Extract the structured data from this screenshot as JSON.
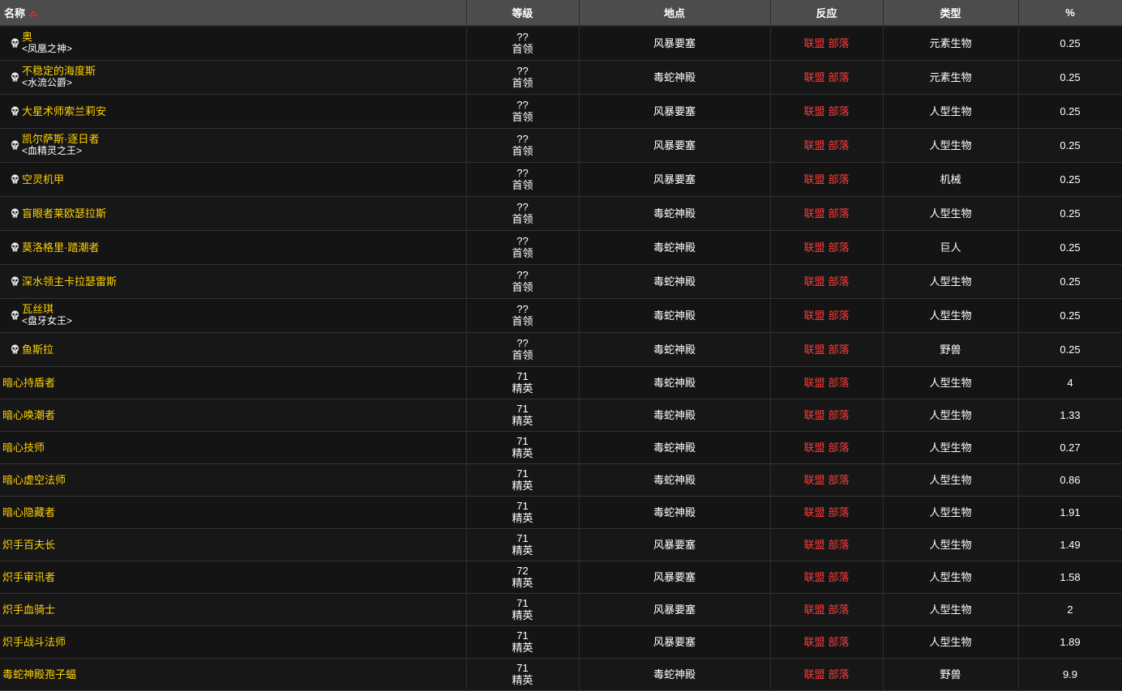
{
  "headers": {
    "name": "名称",
    "level": "等级",
    "location": "地点",
    "reaction": "反应",
    "type": "类型",
    "percent": "%"
  },
  "colors": {
    "npc_name": "#ffd100",
    "reaction": "#ff3b3b",
    "header_bg": "#4c4c4c",
    "row_bg": "#141414"
  },
  "reaction_labels": {
    "alliance": "联盟",
    "horde": "部落"
  },
  "rows": [
    {
      "boss": true,
      "name": "奥",
      "title": "<凤凰之神>",
      "level": "??",
      "rank": "首领",
      "location": "风暴要塞",
      "type": "元素生物",
      "percent": "0.25"
    },
    {
      "boss": true,
      "name": "不稳定的海度斯",
      "title": "<水流公爵>",
      "level": "??",
      "rank": "首领",
      "location": "毒蛇神殿",
      "type": "元素生物",
      "percent": "0.25"
    },
    {
      "boss": true,
      "name": "大星术师索兰莉安",
      "title": "",
      "level": "??",
      "rank": "首领",
      "location": "风暴要塞",
      "type": "人型生物",
      "percent": "0.25"
    },
    {
      "boss": true,
      "name": "凯尔萨斯·逐日者",
      "title": "<血精灵之王>",
      "level": "??",
      "rank": "首领",
      "location": "风暴要塞",
      "type": "人型生物",
      "percent": "0.25"
    },
    {
      "boss": true,
      "name": "空灵机甲",
      "title": "",
      "level": "??",
      "rank": "首领",
      "location": "风暴要塞",
      "type": "机械",
      "percent": "0.25"
    },
    {
      "boss": true,
      "name": "盲眼者莱欧瑟拉斯",
      "title": "",
      "level": "??",
      "rank": "首领",
      "location": "毒蛇神殿",
      "type": "人型生物",
      "percent": "0.25"
    },
    {
      "boss": true,
      "name": "莫洛格里·踏潮者",
      "title": "",
      "level": "??",
      "rank": "首领",
      "location": "毒蛇神殿",
      "type": "巨人",
      "percent": "0.25"
    },
    {
      "boss": true,
      "name": "深水领主卡拉瑟雷斯",
      "title": "",
      "level": "??",
      "rank": "首领",
      "location": "毒蛇神殿",
      "type": "人型生物",
      "percent": "0.25"
    },
    {
      "boss": true,
      "name": "瓦丝琪",
      "title": "<盘牙女王>",
      "level": "??",
      "rank": "首领",
      "location": "毒蛇神殿",
      "type": "人型生物",
      "percent": "0.25"
    },
    {
      "boss": true,
      "name": "鱼斯拉",
      "title": "",
      "level": "??",
      "rank": "首领",
      "location": "毒蛇神殿",
      "type": "野兽",
      "percent": "0.25"
    },
    {
      "boss": false,
      "name": "暗心持盾者",
      "title": "",
      "level": "71",
      "rank": "精英",
      "location": "毒蛇神殿",
      "type": "人型生物",
      "percent": "4"
    },
    {
      "boss": false,
      "name": "暗心唤潮者",
      "title": "",
      "level": "71",
      "rank": "精英",
      "location": "毒蛇神殿",
      "type": "人型生物",
      "percent": "1.33"
    },
    {
      "boss": false,
      "name": "暗心技师",
      "title": "",
      "level": "71",
      "rank": "精英",
      "location": "毒蛇神殿",
      "type": "人型生物",
      "percent": "0.27"
    },
    {
      "boss": false,
      "name": "暗心虚空法师",
      "title": "",
      "level": "71",
      "rank": "精英",
      "location": "毒蛇神殿",
      "type": "人型生物",
      "percent": "0.86"
    },
    {
      "boss": false,
      "name": "暗心隐藏者",
      "title": "",
      "level": "71",
      "rank": "精英",
      "location": "毒蛇神殿",
      "type": "人型生物",
      "percent": "1.91"
    },
    {
      "boss": false,
      "name": "炽手百夫长",
      "title": "",
      "level": "71",
      "rank": "精英",
      "location": "风暴要塞",
      "type": "人型生物",
      "percent": "1.49"
    },
    {
      "boss": false,
      "name": "炽手审讯者",
      "title": "",
      "level": "72",
      "rank": "精英",
      "location": "风暴要塞",
      "type": "人型生物",
      "percent": "1.58"
    },
    {
      "boss": false,
      "name": "炽手血骑士",
      "title": "",
      "level": "71",
      "rank": "精英",
      "location": "风暴要塞",
      "type": "人型生物",
      "percent": "2"
    },
    {
      "boss": false,
      "name": "炽手战斗法师",
      "title": "",
      "level": "71",
      "rank": "精英",
      "location": "风暴要塞",
      "type": "人型生物",
      "percent": "1.89"
    },
    {
      "boss": false,
      "name": "毒蛇神殿孢子蝠",
      "title": "",
      "level": "71",
      "rank": "精英",
      "location": "毒蛇神殿",
      "type": "野兽",
      "percent": "9.9"
    }
  ]
}
